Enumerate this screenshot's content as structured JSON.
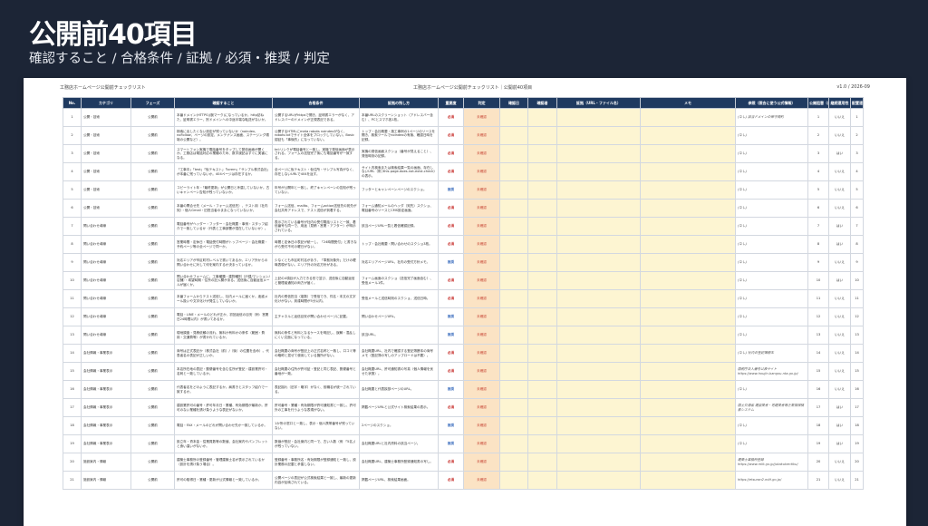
{
  "slide": {
    "title": "公開前40項目",
    "subtitle": "確認すること / 合格条件 / 証拠 / 必須・推奨 / 判定"
  },
  "sheet": {
    "left_title": "工務店ホームページ公開前チェックリスト",
    "center_title": "工務店ホームページ公開前チェックリスト｜公開前40項目",
    "version": "v1.0 / 2026-09"
  },
  "columns": [
    "No.",
    "カテゴリ",
    "フェーズ",
    "確認すること",
    "合格条件",
    "証拠の残し方",
    "重要度",
    "判定",
    "確認日",
    "確認者",
    "証拠（URL・ファイル名）",
    "メモ",
    "参照（照合に使う公式情報）",
    "公開阻害（自動）",
    "継続運用性",
    "配置速度（自動）"
  ],
  "rows": [
    {
      "no": "1",
      "cat": "公開・技術",
      "phase": "公開前",
      "check": "本番ドメイン(HTTPS)(腕マーク)になっているか。http訪ねた、証明書エラー、別ドメインへの中途半端な転送がないか。",
      "pass": "公開するURLがhttpsで開き、証明書エラーがなく、アドレスバーのドメインが正規表記である。",
      "evidence": "本番URLのスクリーンショット（アドレスバー含む）、PCとスマホ各1枚。",
      "imp": "必須",
      "judge": "未確認",
      "ref": "(なし) 該当ドメインの保守規約",
      "auto": "1",
      "cont": "いいえ",
      "speed": "1"
    },
    {
      "no": "2",
      "cat": "公開・技術",
      "phase": "公開前",
      "check": "検索に出したくない設定が残っていないか（noindex、noFollow、ページの設定、メンテナンス画面、ステージング環境の公開など）。",
      "pass": "公開するHTMLにmeta robots noindexがなく、robots.txtでサイト全体をブロックしていない。Basic認証も「事後的」になっていない。",
      "evidence": "トップ・会社概要・施工事例の1ページのソースを開き、検索ツールでnoindexの有無、確認日時を記録。",
      "imp": "必須",
      "judge": "未確認",
      "ref": "(なし)",
      "auto": "2",
      "cont": "いいえ",
      "speed": "2"
    },
    {
      "no": "3",
      "cat": "公開・技術",
      "phase": "公開前",
      "check": "スマートフォン実機で電話番号をタップして発信画面が開くか。工務店は電話対応の業種のため、数字誤記はすぐに実害になる。",
      "pass": "tel:リンクが電話番号と一致し、実機で発信画面が表示される。フォームの送信完了後にも電話番号が一致する。",
      "evidence": "実機の発信画面スクショ（番号が見えること）、発信時刻の記録。",
      "imp": "必須",
      "judge": "未確認",
      "ref": "(なし)",
      "auto": "3",
      "cont": "はい",
      "speed": "3"
    },
    {
      "no": "4",
      "cat": "公開・技術",
      "phase": "公開前",
      "check": "「工事中」「test」「仮テキスト」「lorem」「サンプル株式会社」が本番に残っていないか。404ページは存在するか。",
      "pass": "全ページに仮テキスト・仮住所・サンプル写真がなく、存在しないURLで404を返す。",
      "evidence": "サイト内検索または検索結果一覧の画面、存在しないURL（例 /this-page-does-not-exist-check）の表示。",
      "imp": "必須",
      "judge": "未確認",
      "ref": "(なし)",
      "auto": "4",
      "cont": "いいえ",
      "speed": "4"
    },
    {
      "no": "5",
      "cat": "公開・技術",
      "phase": "公開前",
      "check": "コピーライト年・「最終更新」が公開日と矛盾していないか。古いキャンペーン告知が残っていないか。",
      "pass": "年号が公開年と一致し、終了キャンペーンの告知が残っていない。",
      "evidence": "フッターとキャンペーンページのスクショ。",
      "imp": "推奨",
      "judge": "未確認",
      "ref": "(なし)",
      "auto": "5",
      "cont": "いいえ",
      "speed": "5"
    },
    {
      "no": "6",
      "cat": "公開・技術",
      "phase": "公開前",
      "check": "本番の問合せ先（メール・フォーム送信先）、テスト用（社内宛）・個人Gmail・旧担当者のままになっていないか。",
      "pass": "フォーム送信、mailto、フォームaction送信先の宛先が会社共有アドレスで、テスト送信が到着する。",
      "evidence": "フォーム通知メールのヘッダ（宛先）スクショ、電話番号のソースとCMS設定画面。",
      "imp": "必須",
      "judge": "未確認",
      "ref": "(なし)",
      "auto": "6",
      "cont": "いいえ",
      "speed": "6"
    },
    {
      "no": "7",
      "cat": "問い合わせ導線",
      "phase": "公開前",
      "check": "電話番号がヘッダー・フッター・会社概要・事例・スタッフ紹介で一致しているか（代表と工事部署が混在していないか）。",
      "pass": "表示されている番号が社内の受付電話リストと一致、着信番号も同一で、用途（見積・営業・アフター）が明示されている。",
      "evidence": "該当ページURL一覧と着信確認記録。",
      "imp": "必須",
      "judge": "未確認",
      "ref": "(なし)",
      "auto": "7",
      "cont": "はい",
      "speed": "7"
    },
    {
      "no": "8",
      "cat": "問い合わせ導線",
      "phase": "公開前",
      "check": "営業時間・定休日・電話受付時間がトップページ・会社概要・予約ページ等の全ページで同一か。",
      "pass": "時間と定休日の表記が統一し、「24時間受付」と書きながら受付不可の曜日がない。",
      "evidence": "トップ・会社概要・問い合わせのスクショ3枚。",
      "imp": "必須",
      "judge": "未確認",
      "ref": "(なし)",
      "auto": "8",
      "cont": "はい",
      "speed": "8"
    },
    {
      "no": "9",
      "cat": "問い合わせ導線",
      "phase": "公開前",
      "check": "対応エリアが市区町村レベルで書いてあるか。エリア外からの問い合わせに対して何を案内するか決まっているか。",
      "pass": "少なくとも市区町村名があり、「準拠対象外」だけの曖昧表現がない。エリア外の対応方針がある。",
      "evidence": "対応エリアページURL、社内の受付方針メモ。",
      "imp": "推奨",
      "judge": "未確認",
      "ref": "(なし)",
      "auto": "9",
      "cont": "いいえ",
      "speed": "9"
    },
    {
      "no": "10",
      "cat": "問い合わせ導線",
      "phase": "公開前",
      "check": "問い合わせフォームに、工事種類・建物種別（戸建/マンション/店舗）・希望時期・住所の記入欄がある。送信後に自動返信メールが届くか。",
      "pass": "上記の4項目が入力できる形で並び、送信後に自動返信と管理者通知の両方が届く。",
      "evidence": "フォーム画面のスクショ（送信完了画面含む）、受信メール1件。",
      "imp": "必須",
      "judge": "未確認",
      "ref": "(なし)",
      "auto": "10",
      "cont": "はい",
      "speed": "10"
    },
    {
      "no": "11",
      "cat": "問い合わせ導線",
      "phase": "公開前",
      "check": "本番フォームからテスト送信し、社内メールに届くか。迷惑メール扱いや文字化けが発生していないか。",
      "pass": "社内の受信担当（複数）で受信でき、件名・本文の文字化けがない。到達時間が5分以内。",
      "evidence": "受信メールと送信時刻のスクショ、送信日時。",
      "imp": "必須",
      "judge": "未確認",
      "ref": "(なし)",
      "auto": "11",
      "cont": "いいえ",
      "speed": "11"
    },
    {
      "no": "12",
      "cat": "問い合わせ導線",
      "phase": "公開前",
      "check": "電話・LINE・メールのどれが正か、初回返信の目安（例：営業日24時間以内）が書いてあるか。",
      "pass": "主チャネルと返信目安が問い合わせページに記載。",
      "evidence": "問い合わせページURL。",
      "imp": "推奨",
      "judge": "未確認",
      "ref": "(なし)",
      "auto": "12",
      "cont": "いいえ",
      "speed": "12"
    },
    {
      "no": "13",
      "cat": "問い合わせ導線",
      "phase": "公開前",
      "check": "現地調査・見積依頼の流れ、無料か有料かの条件（範囲・費用・交通費等）が書かれているか。",
      "pass": "無料の条件と有料となるケースを明記し、誤解・混乱しにくい文面になっている。",
      "evidence": "該当URL。",
      "imp": "推奨",
      "judge": "未確認",
      "ref": "(なし)",
      "auto": "13",
      "cont": "いいえ",
      "speed": "13"
    },
    {
      "no": "14",
      "cat": "会社情報・事業表示",
      "phase": "公開前",
      "check": "商号は正式表記か（株式会社（前）/（後）の位置を含め）。代表者名の表記が正しいか。",
      "pass": "会社概要の商号が登記上の正式名称と一致し、口コミ等の略称と混ぜて使用している箇所がない。",
      "evidence": "会社概要URL、社内で確認する登記簿謄本の商号メモ（登記簿の写しのアップロードは不要）。",
      "imp": "必須",
      "judge": "未確認",
      "ref": "(なし) 社内の登記簿謄本",
      "auto": "14",
      "cont": "いいえ",
      "speed": "14"
    },
    {
      "no": "15",
      "cat": "会社情報・事業表示",
      "phase": "公開前",
      "check": "本店所在地の表記・郵便番号を含む住所が登記・建設業許可・名刺と一致しているか。",
      "pass": "会社概要の住所が許可証・登記と同じ表記、郵便番号と番地が一致。",
      "evidence": "会社概要URL、許可通知書の写真（個人情報を伏せた状態）。",
      "imp": "必須",
      "judge": "未確認",
      "ref": "国税庁法人番号公表サイト https://www.houjin-bangou.nta.go.jp/",
      "auto": "15",
      "cont": "いいえ",
      "speed": "15"
    },
    {
      "no": "16",
      "cat": "会社情報・事業表示",
      "phase": "公開前",
      "check": "代表者名をどのように表記するか。肩書きとスタッフ紹介で一致するか。",
      "pass": "表記揺れ（旧字・略字）がなく、役職名が統一されている。",
      "evidence": "会社概要と代表挨拶ページのURL。",
      "imp": "推奨",
      "judge": "未確認",
      "ref": "(なし)",
      "auto": "16",
      "cont": "いいえ",
      "speed": "16"
    },
    {
      "no": "17",
      "cat": "会社情報・事業表示",
      "phase": "公開前",
      "check": "建設業許可の番号・許可年月日・業種、有効期限が最新か。許可のない業種を請け負うような表記がないか。",
      "pass": "許可番号・業種・有効期限が許可通知書と一致し、許可外の工事を行うような表現がない。",
      "evidence": "掲載ページURLと公式サイト検索結果の表示。",
      "imp": "必須",
      "judge": "未確認",
      "ref": "国土交通省 建設業者・宅建業者等企業情報検索システム",
      "auto": "17",
      "cont": "はい",
      "speed": "17"
    },
    {
      "no": "18",
      "cat": "会社情報・事業表示",
      "phase": "公開前",
      "check": "電話・FAX・メールのどれが問い合わせ先か一致しているか。",
      "pass": "1か所の窓口と一致し、表示・個人携帯番号が残っていない。",
      "evidence": "2ページのスクショ。",
      "imp": "推奨",
      "judge": "未確認",
      "ref": "(なし)",
      "auto": "18",
      "cont": "はい",
      "speed": "18"
    },
    {
      "no": "19",
      "cat": "会社情報・事業表示",
      "phase": "公開前",
      "check": "設立年・資本金・従業員数等の数値、会社案内やパンフレットと食い違いがないか。",
      "pass": "数値が登記・会社案内と同一で、古い人数（例 「5名」）が残っていない。",
      "evidence": "会社概要URLと社内資料の該当ページ。",
      "imp": "推奨",
      "judge": "未確認",
      "ref": "(なし)",
      "auto": "19",
      "cont": "はい",
      "speed": "19"
    },
    {
      "no": "20",
      "cat": "施設案内・情報",
      "phase": "公開前",
      "check": "建築士事務所の登録番号・管理建築士名が表示されているか（設計を請け負う場合）。",
      "pass": "登録番号・事務所名・有効期限が登録通知と一致し、設計業務の記載と矛盾しない。",
      "evidence": "会社概要URL、建築士事務所登録通知書の写し。",
      "imp": "必須",
      "judge": "未確認",
      "ref": "建築士事務所登録 https://www.mlit.go.jp/jutakukentiku/",
      "auto": "20",
      "cont": "いいえ",
      "speed": "20"
    },
    {
      "no": "21",
      "cat": "施設案内・情報",
      "phase": "公開前",
      "check": "許可の取得日・業種・更新が公式情報と一致しているか。",
      "pass": "公開ページの表記が公式検索結果と一致し、最新の更新内容が反映されている。",
      "evidence": "掲載ページURL、検索結果画面。",
      "imp": "必須",
      "judge": "未確認",
      "ref": "https://etsuran2.mlit.go.jp/",
      "auto": "21",
      "cont": "いいえ",
      "speed": "21"
    }
  ]
}
